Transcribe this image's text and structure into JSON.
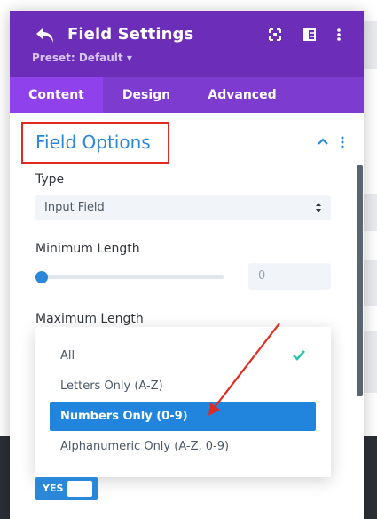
{
  "header": {
    "title": "Field Settings",
    "preset": "Preset: Default ▾",
    "icons": [
      "back-icon",
      "expand-icon",
      "sidebar-layout-icon",
      "more-icon"
    ]
  },
  "tabs": [
    {
      "label": "Content",
      "active": true
    },
    {
      "label": "Design",
      "active": false
    },
    {
      "label": "Advanced",
      "active": false
    }
  ],
  "section": {
    "title": "Field Options",
    "type_label": "Type",
    "type_value": "Input Field",
    "min_length_label": "Minimum Length",
    "min_length_value": "0",
    "min_length_level": 0,
    "max_length_label": "Maximum Length"
  },
  "dropdown": {
    "options": [
      {
        "label": "All",
        "checked": true
      },
      {
        "label": "Letters Only (A-Z)",
        "checked": false
      },
      {
        "label": "Numbers Only (0-9)",
        "checked": false,
        "selected": true
      },
      {
        "label": "Alphanumeric Only (A-Z, 0-9)",
        "checked": false
      }
    ]
  },
  "toggle": {
    "label": "YES",
    "on": true
  },
  "colors": {
    "header": "#6c2eb9",
    "tabs": "#7e3bd0",
    "accent": "#2b87da",
    "highlight": "#e02b20",
    "check": "#29c4a9"
  }
}
